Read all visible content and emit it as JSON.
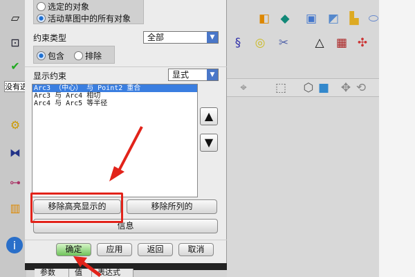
{
  "selection": {
    "options": [
      "选定的对象",
      "活动草图中的所有对象"
    ],
    "selected": 1
  },
  "constraint_type": {
    "label": "约束类型",
    "value": "全部",
    "options": [
      "包含",
      "排除"
    ],
    "selected": 0
  },
  "display": {
    "label": "显示约束",
    "value": "显式"
  },
  "constraints": [
    "Arc3 （中心） 与 Point2 重合",
    "Arc3 与 Arc4 相切",
    "Arc4 与 Arc5 等半径"
  ],
  "buttons": {
    "remove_highlighted": "移除高亮显示的",
    "remove_listed": "移除所列的",
    "info": "信息",
    "ok": "确定",
    "apply": "应用",
    "back": "返回",
    "cancel": "取消"
  },
  "left_input": "没有选",
  "table_headers": [
    "参数",
    "值",
    "表达式"
  ],
  "colors": {
    "highlight": "#3a7ee0",
    "annotation": "#e2231a"
  }
}
